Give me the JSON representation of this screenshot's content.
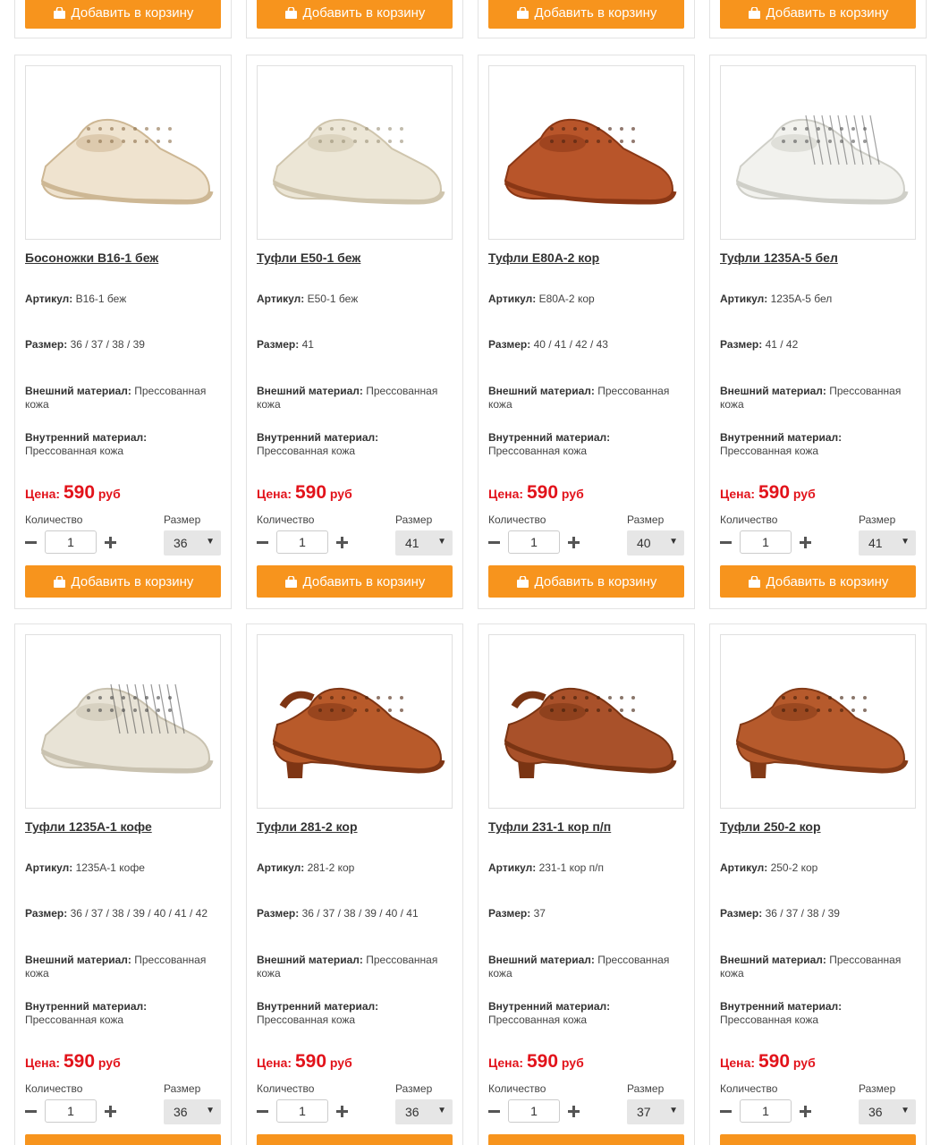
{
  "ui": {
    "add_to_cart": "Добавить в корзину",
    "article_label": "Артикул:",
    "size_label": "Размер:",
    "outer_label": "Внешний материал:",
    "inner_label": "Внутренний материал:",
    "price_label": "Цена:",
    "currency": "руб",
    "qty_label": "Количество",
    "size_select_label": "Размер",
    "bag_icon": "shopping-bag-icon",
    "accent_color": "#f7941d",
    "price_color": "#e2131b"
  },
  "products": [
    {
      "title": "Босоножки B16-1 беж",
      "article": "B16-1 беж",
      "sizes": "36 / 37 / 38 / 39",
      "outer": "Прессованная кожа",
      "inner": "Прессованная кожа",
      "price": "590",
      "qty": "1",
      "selected_size": "36",
      "image": "beige-sandal"
    },
    {
      "title": "Туфли E50-1 беж",
      "article": "E50-1 беж",
      "sizes": "41",
      "outer": "Прессованная кожа",
      "inner": "Прессованная кожа",
      "price": "590",
      "qty": "1",
      "selected_size": "41",
      "image": "beige-loafer"
    },
    {
      "title": "Туфли E80A-2 кор",
      "article": "E80A-2 кор",
      "sizes": "40 / 41 / 42 / 43",
      "outer": "Прессованная кожа",
      "inner": "Прессованная кожа",
      "price": "590",
      "qty": "1",
      "selected_size": "40",
      "image": "brown-loafer"
    },
    {
      "title": "Туфли 1235A-5 бел",
      "article": "1235A-5 бел",
      "sizes": "41 / 42",
      "outer": "Прессованная кожа",
      "inner": "Прессованная кожа",
      "price": "590",
      "qty": "1",
      "selected_size": "41",
      "image": "white-woven-loafer"
    },
    {
      "title": "Туфли 1235A-1 кофе",
      "article": "1235A-1 кофе",
      "sizes": "36 / 37 / 38 / 39 / 40 / 41 / 42",
      "outer": "Прессованная кожа",
      "inner": "Прессованная кожа",
      "price": "590",
      "qty": "1",
      "selected_size": "36",
      "image": "cream-woven-loafer"
    },
    {
      "title": "Туфли 281-2 кор",
      "article": "281-2 кор",
      "sizes": "36 / 37 / 38 / 39 / 40 / 41",
      "outer": "Прессованная кожа",
      "inner": "Прессованная кожа",
      "price": "590",
      "qty": "1",
      "selected_size": "36",
      "image": "brown-slingback-sandal"
    },
    {
      "title": "Туфли 231-1 кор п/п",
      "article": "231-1 кор п/п",
      "sizes": "37",
      "outer": "Прессованная кожа",
      "inner": "Прессованная кожа",
      "price": "590",
      "qty": "1",
      "selected_size": "37",
      "image": "brown-slingback-shoe"
    },
    {
      "title": "Туфли 250-2 кор",
      "article": "250-2 кор",
      "sizes": "36 / 37 / 38 / 39",
      "outer": "Прессованная кожа",
      "inner": "Прессованная кожа",
      "price": "590",
      "qty": "1",
      "selected_size": "36",
      "image": "brown-heel-shoe"
    }
  ]
}
